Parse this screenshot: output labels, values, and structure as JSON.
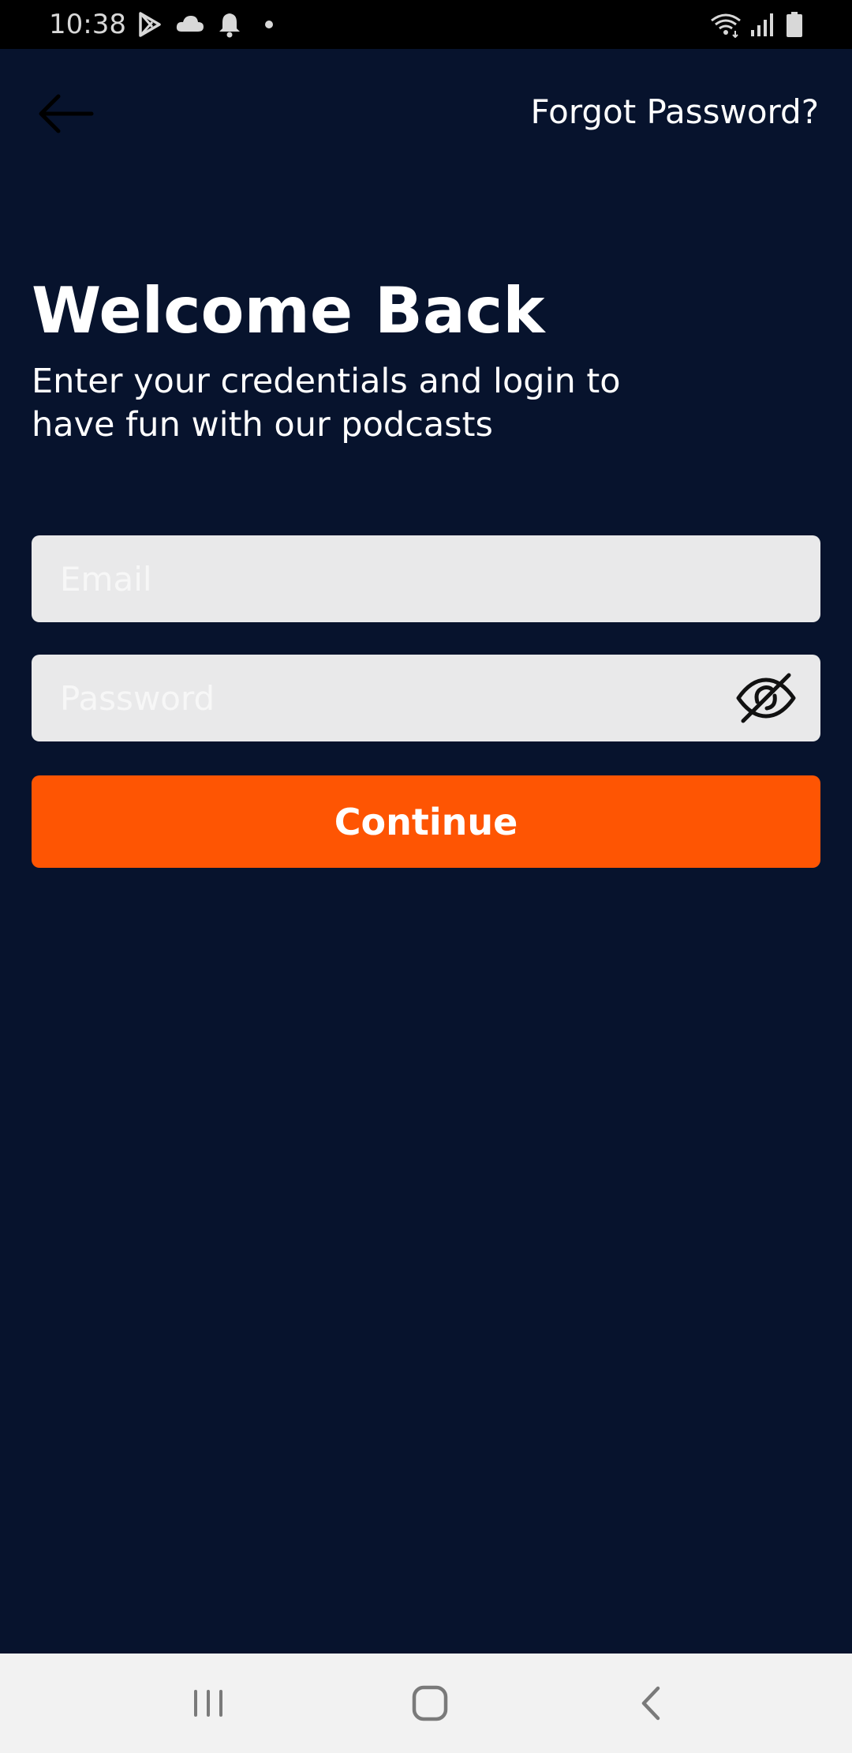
{
  "status_bar": {
    "time": "10:38"
  },
  "header": {
    "back_icon": "arrow-left-icon",
    "forgot_password_label": "Forgot Password?"
  },
  "main": {
    "title": "Welcome Back",
    "subtitle": "Enter your credentials and login to have fun with our podcasts"
  },
  "form": {
    "email": {
      "placeholder": "Email",
      "value": ""
    },
    "password": {
      "placeholder": "Password",
      "value": "",
      "toggle_icon": "eye-slash-icon"
    },
    "continue_label": "Continue"
  },
  "nav_bar": {
    "recents_icon": "recents-icon",
    "home_icon": "home-icon",
    "back_icon": "back-chevron-icon"
  },
  "colors": {
    "background": "#07132d",
    "accent": "#fe5503",
    "input_background": "#e9e9ea"
  }
}
